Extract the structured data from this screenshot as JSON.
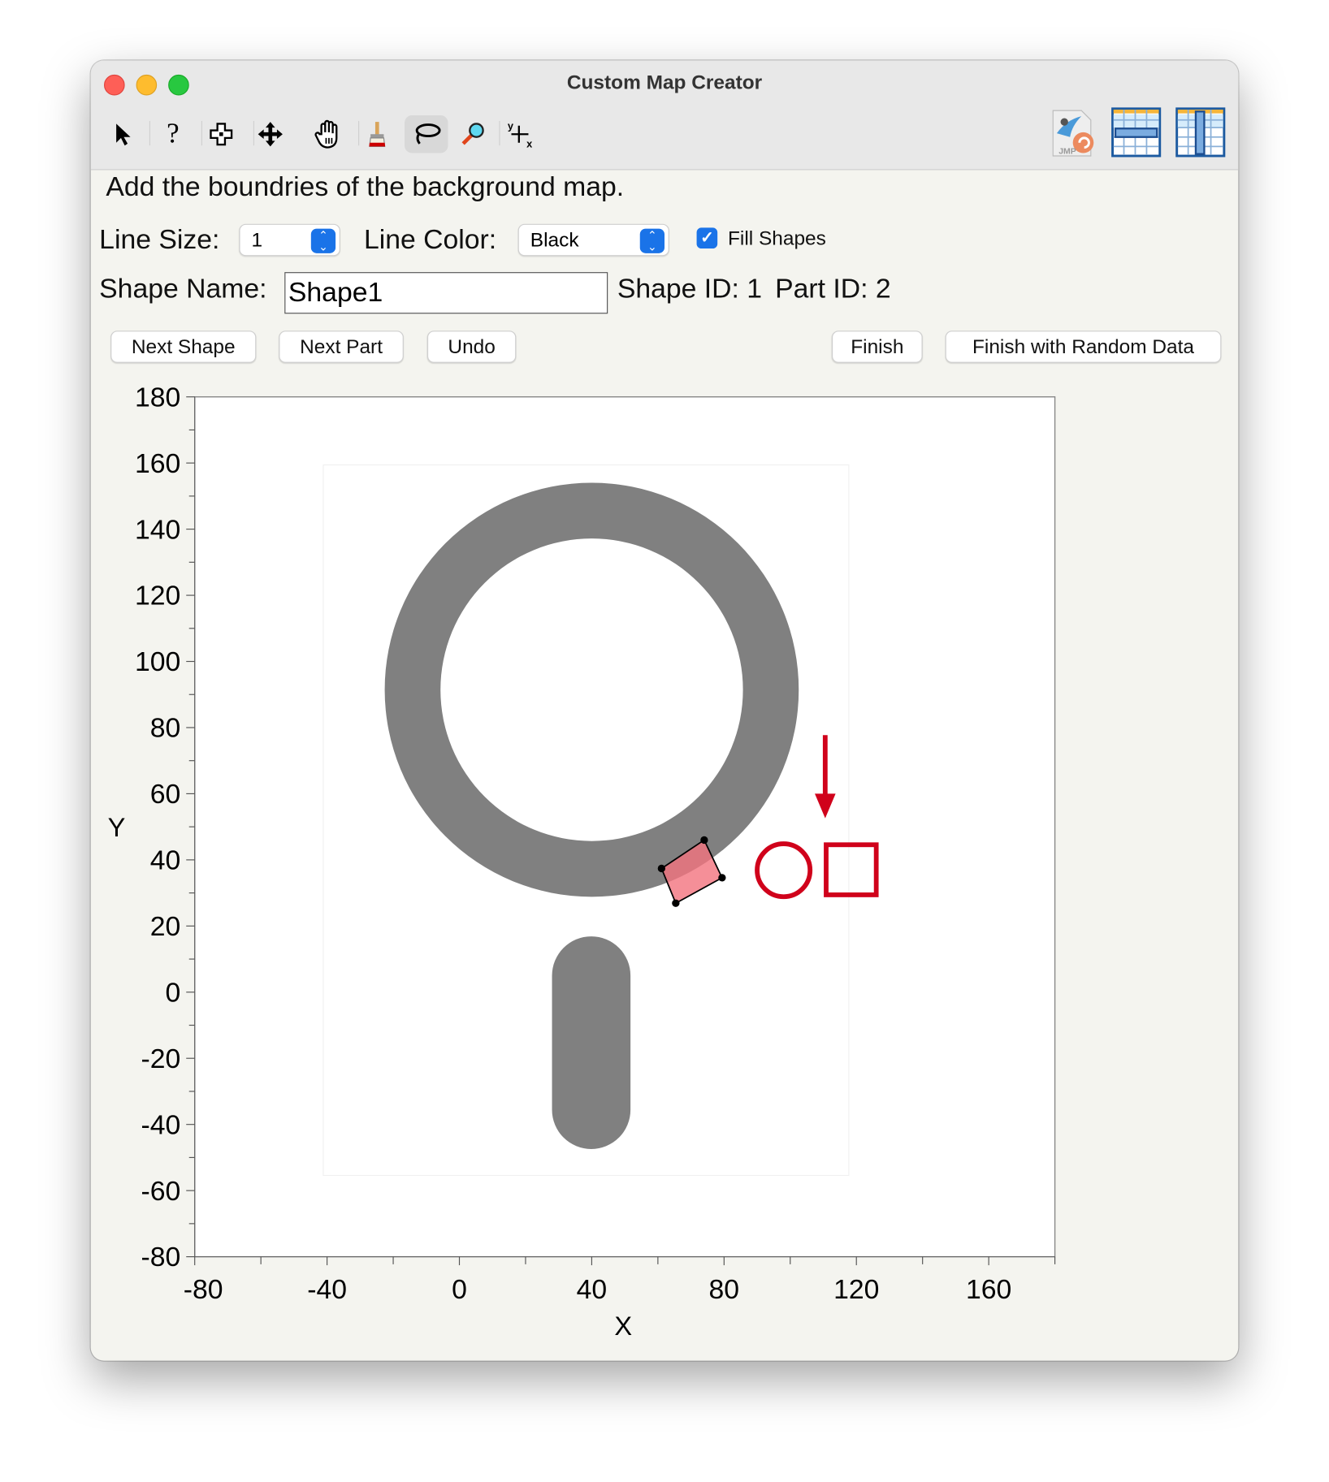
{
  "window": {
    "title": "Custom Map Creator"
  },
  "toolbar": {
    "tools": [
      "arrow-tool",
      "help-tool",
      "selection-tool",
      "move-tool",
      "hand-tool",
      "brush-tool",
      "lasso-tool",
      "magnifier-tool",
      "crosshair-tool"
    ],
    "active": "lasso-tool",
    "right_icons": [
      "jmp-revert",
      "row-select",
      "column-select"
    ],
    "crosshair_y": "y",
    "crosshair_x": "x",
    "jmp_label": "JMP"
  },
  "instruction": "Add the boundries of the background map.",
  "controls": {
    "line_size_label": "Line Size:",
    "line_size_value": "1",
    "line_color_label": "Line Color:",
    "line_color_value": "Black",
    "fill_shapes_label": "Fill Shapes",
    "fill_shapes_checked": true,
    "shape_name_label": "Shape Name:",
    "shape_name_value": "Shape1",
    "shape_id_text": "Shape ID: 1",
    "part_id_text": "Part ID: 2"
  },
  "buttons": {
    "next_shape": "Next Shape",
    "next_part": "Next Part",
    "undo": "Undo",
    "finish": "Finish",
    "finish_random": "Finish with Random Data"
  },
  "plot": {
    "xlabel": "X",
    "ylabel": "Y",
    "xlim": [
      -80,
      180
    ],
    "ylim": [
      -80,
      180
    ],
    "xticks": [
      "-80",
      "-40",
      "0",
      "40",
      "80",
      "120",
      "160"
    ],
    "yticks": [
      "180",
      "160",
      "140",
      "120",
      "100",
      "80",
      "60",
      "40",
      "20",
      "0",
      "-20",
      "-40",
      "-60",
      "-80"
    ],
    "accent": "#d0021b",
    "shape_fill": "#808080",
    "polygon_points": [
      [
        61.1,
        37.4
      ],
      [
        74,
        46
      ],
      [
        79.4,
        34.6
      ],
      [
        65.4,
        26.9
      ]
    ]
  }
}
